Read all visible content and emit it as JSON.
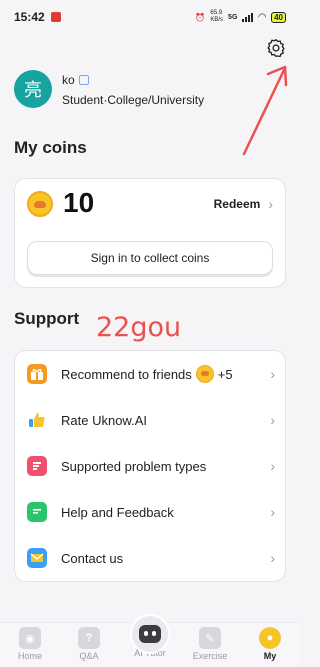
{
  "status_bar": {
    "time": "15:42",
    "net_speed": "65.9",
    "net_unit": "KB/s",
    "network_type": "5G",
    "battery": "40"
  },
  "profile": {
    "avatar_char": "亮",
    "name": "ko",
    "role": "Student·College/University"
  },
  "coins": {
    "section_title": "My coins",
    "count": "10",
    "redeem_label": "Redeem",
    "sign_in_label": "Sign in to collect coins"
  },
  "overlay_text": "22gou",
  "support": {
    "section_title": "Support",
    "items": [
      {
        "label": "Recommend to friends",
        "bonus": "+5",
        "icon": "gift-icon"
      },
      {
        "label": "Rate Uknow.AI",
        "icon": "thumbs-up-icon"
      },
      {
        "label": "Supported problem types",
        "icon": "list-icon"
      },
      {
        "label": "Help and Feedback",
        "icon": "chat-icon"
      },
      {
        "label": "Contact us",
        "icon": "mail-icon"
      }
    ]
  },
  "bottom_nav": {
    "items": [
      {
        "label": "Home",
        "icon": "camera-icon"
      },
      {
        "label": "Q&A",
        "icon": "question-icon"
      },
      {
        "label": "AI Tutor",
        "icon": "robot-icon"
      },
      {
        "label": "Exercise",
        "icon": "pencil-icon"
      },
      {
        "label": "My",
        "icon": "profile-icon",
        "active": true
      }
    ]
  },
  "colors": {
    "avatar_bg": "#17a3a0",
    "coin": "#f7c52a",
    "overlay_text": "#ee4f4f",
    "arrow": "#ee4f4f"
  }
}
